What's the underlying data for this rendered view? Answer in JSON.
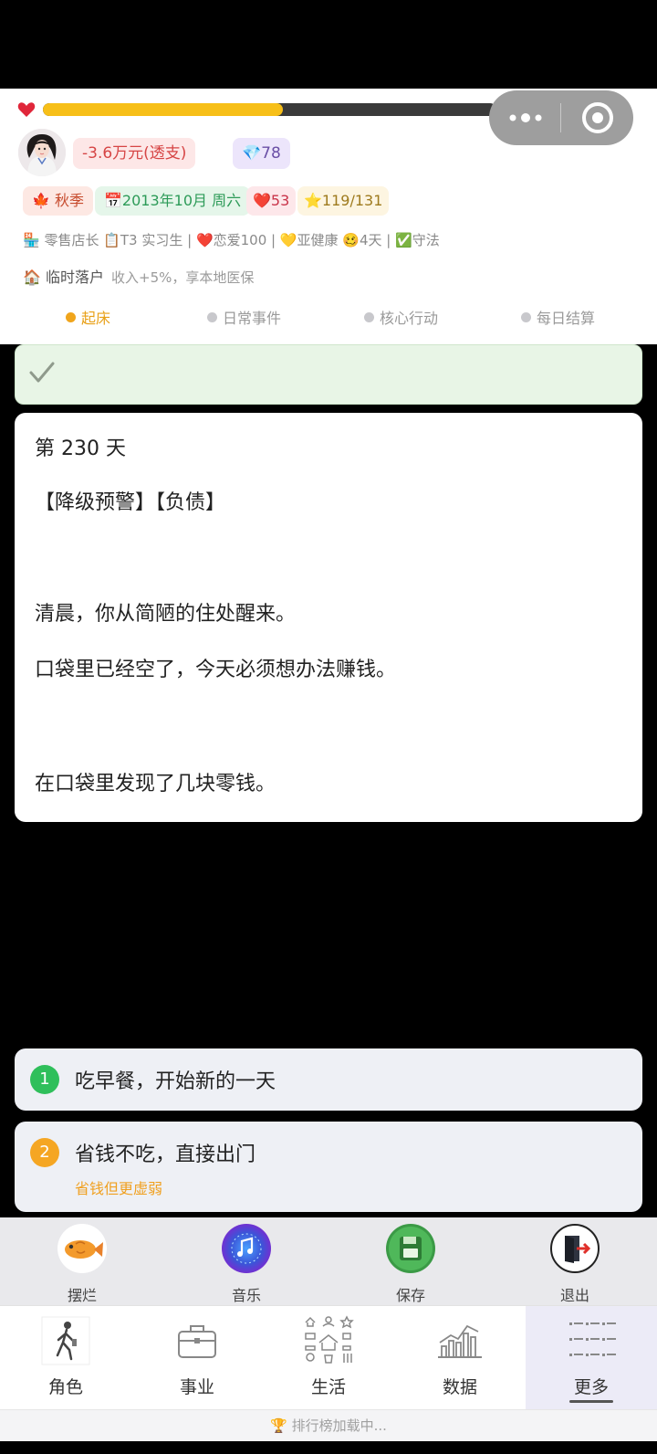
{
  "hp": {
    "value_label": "53",
    "fraction": 0.53
  },
  "money": {
    "icon": "money-bag-icon",
    "text": "-3.6万元(透支)"
  },
  "gems": {
    "icon": "diamond-icon",
    "text": "78"
  },
  "chips": {
    "season": "🍁 秋季",
    "date": "📅2013年10月 周六",
    "heart": "❤️53",
    "star": "⭐119/131"
  },
  "status_line": "🏪 零售店长 📋T3 实习生 | ❤️恋爱100 | 💛亚健康 🥴4天 | ✅守法",
  "hukou": {
    "label": "🏠 临时落户",
    "note": "收入+5%，享本地医保"
  },
  "phases": [
    {
      "label": "起床",
      "active": true
    },
    {
      "label": "日常事件",
      "active": false
    },
    {
      "label": "核心行动",
      "active": false
    },
    {
      "label": "每日结算",
      "active": false
    }
  ],
  "story": {
    "day": "第 230 天",
    "tags": "【降级预警】【负债】",
    "line1": "清晨，你从简陋的住处醒来。",
    "line2": "口袋里已经空了，今天必须想办法赚钱。",
    "line3": "在口袋里发现了几块零钱。"
  },
  "choices": [
    {
      "num": "1",
      "text": "吃早餐，开始新的一天",
      "color": "#2fbf5b"
    },
    {
      "num": "2",
      "text": "省钱不吃，直接出门",
      "sub": "省钱但更虚弱",
      "color": "#f5a623"
    }
  ],
  "tools": [
    {
      "label": "摆烂",
      "icon": "lazy-fish-icon"
    },
    {
      "label": "音乐",
      "icon": "music-icon"
    },
    {
      "label": "保存",
      "icon": "save-icon"
    },
    {
      "label": "退出",
      "icon": "exit-door-icon"
    }
  ],
  "tabs": [
    {
      "label": "角色",
      "icon": "character-icon"
    },
    {
      "label": "事业",
      "icon": "briefcase-icon"
    },
    {
      "label": "生活",
      "icon": "life-grid-icon"
    },
    {
      "label": "数据",
      "icon": "chart-icon"
    },
    {
      "label": "更多",
      "icon": "more-list-icon",
      "active": true
    }
  ],
  "rank_text": "🏆 排行榜加载中..."
}
